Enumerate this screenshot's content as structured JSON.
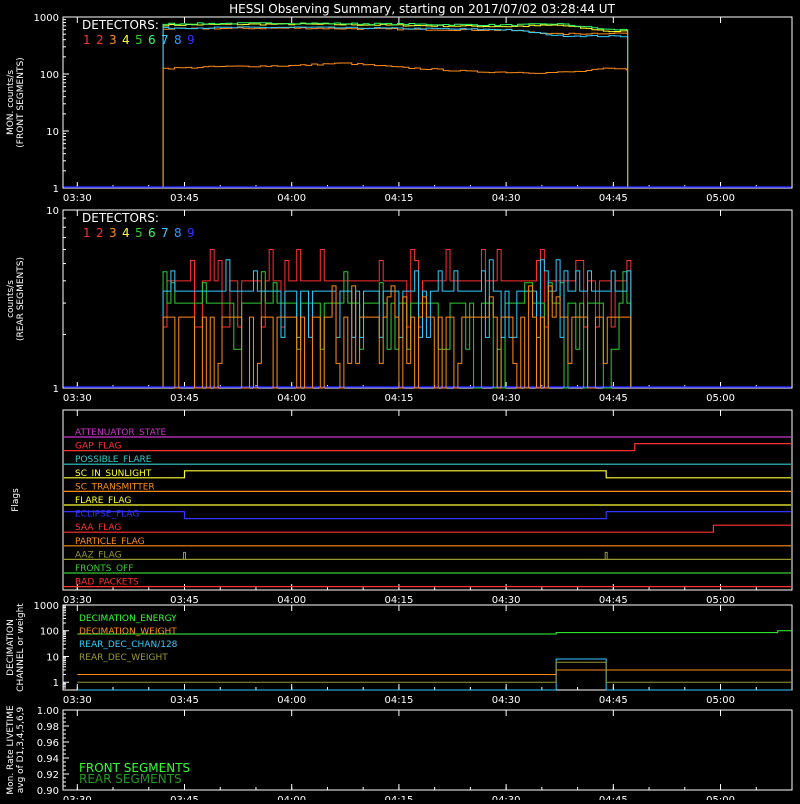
{
  "title": "HESSI Observing Summary, starting on 2017/07/02 03:28:44 UT",
  "time_ticks": [
    "03:30",
    "03:45",
    "04:00",
    "04:15",
    "04:30",
    "04:45",
    "05:00"
  ],
  "detector_colors": [
    "#ff3030",
    "#ff3030",
    "#ff8c1a",
    "#ffff33",
    "#33cc33",
    "#33ff66",
    "#33ccff",
    "#3399ff",
    "#3333ff"
  ],
  "chart_data": [
    {
      "type": "line",
      "ylabel": "MON. counts/s (FRONT SEGMENTS)",
      "ylabel_lines": [
        "MON. counts/s",
        "(FRONT SEGMENTS)"
      ],
      "yscale": "log",
      "ylim": [
        1,
        1000
      ],
      "ytick_labels": [
        "1",
        "10",
        "100",
        "1000"
      ],
      "yticks": [
        1,
        10,
        100,
        1000
      ],
      "legend_title": "DETECTORS:",
      "legend_labels": [
        "1",
        "2",
        "3",
        "4",
        "5",
        "6",
        "7",
        "8",
        "9"
      ],
      "series": [
        {
          "color": "#ffff33",
          "x": [
            "03:42",
            "03:50",
            "04:00",
            "04:10",
            "04:20",
            "04:30",
            "04:37",
            "04:44",
            "04:47"
          ],
          "y": [
            720,
            740,
            750,
            730,
            700,
            680,
            720,
            560,
            560
          ]
        },
        {
          "color": "#33ff66",
          "x": [
            "03:42",
            "03:50",
            "04:00",
            "04:10",
            "04:20",
            "04:30",
            "04:37",
            "04:44",
            "04:47"
          ],
          "y": [
            760,
            770,
            780,
            760,
            740,
            720,
            760,
            600,
            600
          ]
        },
        {
          "color": "#ff8c1a",
          "x": [
            "03:42",
            "03:50",
            "04:00",
            "04:10",
            "04:20",
            "04:30",
            "04:37",
            "04:44",
            "04:47"
          ],
          "y": [
            620,
            630,
            640,
            620,
            600,
            590,
            500,
            520,
            520
          ]
        },
        {
          "color": "#33ccff",
          "x": [
            "03:42",
            "03:50",
            "04:00",
            "04:10",
            "04:20",
            "04:30",
            "04:37",
            "04:44",
            "04:47"
          ],
          "y": [
            640,
            650,
            660,
            640,
            620,
            600,
            470,
            460,
            460
          ]
        },
        {
          "color": "#ff8c1a",
          "x": [
            "03:42",
            "03:50",
            "04:00",
            "04:07",
            "04:15",
            "04:25",
            "04:35",
            "04:40",
            "04:44",
            "04:47"
          ],
          "y": [
            125,
            135,
            140,
            155,
            130,
            110,
            105,
            110,
            125,
            120
          ]
        }
      ]
    },
    {
      "type": "line",
      "ylabel": "counts/s (REAR SEGMENTS)",
      "ylabel_lines": [
        "counts/s",
        "(REAR SEGMENTS)"
      ],
      "yscale": "log",
      "ylim": [
        1,
        10
      ],
      "ytick_labels": [
        "1",
        "10"
      ],
      "yticks": [
        1,
        10
      ],
      "legend_title": "DETECTORS:",
      "legend_labels": [
        "1",
        "2",
        "3",
        "4",
        "5",
        "6",
        "7",
        "8",
        "9"
      ],
      "levels": [
        2,
        2.5,
        3,
        3.5,
        4,
        5,
        6
      ],
      "series": [
        {
          "color": "#ff3030",
          "base": 4,
          "x_range": [
            "03:42",
            "04:47"
          ]
        },
        {
          "color": "#33cc33",
          "base": 3,
          "x_range": [
            "03:42",
            "04:47"
          ]
        },
        {
          "color": "#33ccff",
          "base": 3.5,
          "x_range": [
            "03:42",
            "04:47"
          ]
        },
        {
          "color": "#ff8c1a",
          "base": 2.5,
          "x_range": [
            "03:42",
            "04:47"
          ]
        }
      ]
    },
    {
      "type": "flags",
      "ylabel": "Flags",
      "flags": [
        {
          "label": "ATTENUATOR_STATE",
          "color": "#cc33cc",
          "transitions": []
        },
        {
          "label": "GAP_FLAG",
          "color": "#ff3030",
          "transitions": [
            {
              "x": "04:48",
              "high": true
            }
          ]
        },
        {
          "label": "POSSIBLE_FLARE",
          "color": "#33cccc",
          "transitions": []
        },
        {
          "label": "SC_IN_SUNLIGHT",
          "color": "#ffff33",
          "transitions": [
            {
              "x": "03:45",
              "high": true
            },
            {
              "x": "04:44",
              "high": false
            }
          ]
        },
        {
          "label": "SC_TRANSMITTER",
          "color": "#ff8c1a",
          "transitions": []
        },
        {
          "label": "FLARE_FLAG",
          "color": "#ffff33",
          "transitions": []
        },
        {
          "label": "ECLIPSE_FLAG",
          "color": "#3333ff",
          "transitions": [
            {
              "x": "03:45",
              "high": false
            },
            {
              "x": "04:44",
              "high": true
            }
          ]
        },
        {
          "label": "SAA_FLAG",
          "color": "#ff3030",
          "transitions": [
            {
              "x": "04:59",
              "high": true
            }
          ]
        },
        {
          "label": "PARTICLE_FLAG",
          "color": "#ff8c1a",
          "transitions": []
        },
        {
          "label": "AAZ_FLAG",
          "color": "#999933",
          "transitions": [],
          "spikes": [
            "03:45",
            "04:44"
          ]
        },
        {
          "label": "FRONTS_OFF",
          "color": "#33cc33",
          "transitions": []
        },
        {
          "label": "BAD_PACKETS",
          "color": "#ff3030",
          "transitions": []
        }
      ]
    },
    {
      "type": "line",
      "ylabel": "DECIMATION CHANNEL or weight",
      "ylabel_lines": [
        "DECIMATION",
        "CHANNEL or weight"
      ],
      "yscale": "log",
      "ylim": [
        0.5,
        1000
      ],
      "ytick_labels": [
        "1",
        "10",
        "100",
        "1000"
      ],
      "yticks": [
        1,
        10,
        100,
        1000
      ],
      "legend": [
        {
          "label": "DECIMATION_ENERGY",
          "color": "#33ff33"
        },
        {
          "label": "DECIMATION_WEIGHT",
          "color": "#ff8c1a"
        },
        {
          "label": "REAR_DEC_CHAN/128",
          "color": "#33ccff"
        },
        {
          "label": "REAR_DEC_WEIGHT",
          "color": "#999933"
        }
      ],
      "series": [
        {
          "name": "DECIMATION_ENERGY",
          "color": "#33ff33",
          "x": [
            "03:30",
            "04:37",
            "04:37",
            "05:08",
            "05:08",
            "05:10"
          ],
          "y": [
            75,
            75,
            85,
            85,
            100,
            100
          ]
        },
        {
          "name": "DECIMATION_WEIGHT",
          "color": "#ff8c1a",
          "x": [
            "03:30",
            "04:37",
            "04:37",
            "05:10"
          ],
          "y": [
            2,
            2,
            3,
            3
          ]
        },
        {
          "name": "REAR_DEC_CHAN/128",
          "color": "#33ccff",
          "x": [
            "03:30",
            "04:37",
            "04:37",
            "04:44",
            "04:44",
            "05:10"
          ],
          "y": [
            0.5,
            0.5,
            8,
            8,
            0.5,
            0.5
          ]
        },
        {
          "name": "REAR_DEC_WEIGHT",
          "color": "#999933",
          "x": [
            "03:30",
            "04:37",
            "04:37",
            "04:44",
            "04:44",
            "05:10"
          ],
          "y": [
            1,
            1,
            6,
            6,
            1,
            1
          ]
        }
      ]
    },
    {
      "type": "line",
      "ylabel": "Mon. Rate LIVETIME avg of D1,3,4,5,6,9",
      "ylabel_lines": [
        "Mon. Rate LIVETIME",
        "avg of D1,3,4,5,6,9"
      ],
      "yscale": "linear",
      "ylim": [
        0.9,
        1.0
      ],
      "ytick_labels": [
        "0.90",
        "0.92",
        "0.94",
        "0.96",
        "0.98",
        "1.00"
      ],
      "yticks": [
        0.9,
        0.92,
        0.94,
        0.96,
        0.98,
        1.0
      ],
      "legend": [
        {
          "label": "FRONT SEGMENTS",
          "color": "#33ff33"
        },
        {
          "label": "REAR SEGMENTS",
          "color": "#229922"
        }
      ],
      "series": []
    }
  ]
}
